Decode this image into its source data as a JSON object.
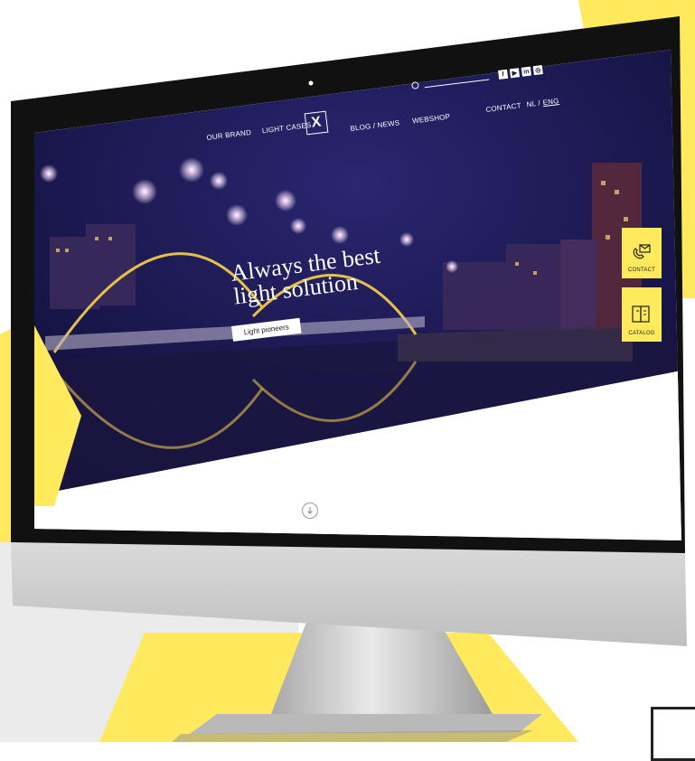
{
  "colors": {
    "accent": "#ffe95c",
    "hero_night": "#18164a",
    "bezel": "#111111",
    "stand": "#c9c9c9"
  },
  "header": {
    "logo_glyph": "X",
    "nav_left": [
      "OUR BRAND",
      "LIGHT CASES"
    ],
    "nav_right": [
      "BLOG / NEWS",
      "WEBSHOP"
    ],
    "contact_label": "CONTACT",
    "lang_nl": "NL /",
    "lang_eng": "ENG",
    "search_icon": "search-icon",
    "social": [
      {
        "icon": "facebook-icon",
        "glyph": "f"
      },
      {
        "icon": "youtube-icon",
        "glyph": "▶"
      },
      {
        "icon": "linkedin-icon",
        "glyph": "in"
      },
      {
        "icon": "instagram-icon",
        "glyph": "◎"
      }
    ]
  },
  "hero": {
    "headline_line1": "Always the best",
    "headline_line2": "light solution",
    "cta_label": "Light pioneers"
  },
  "side_tabs": {
    "contact_label": "CONTACT",
    "catalog_label": "CATALOG"
  },
  "scroll": {
    "icon": "arrow-down-circle-icon"
  }
}
